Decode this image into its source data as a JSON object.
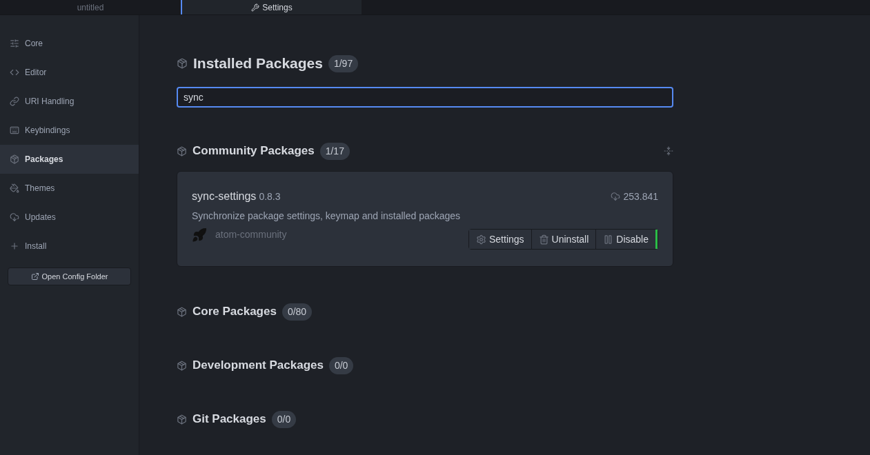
{
  "tabs": [
    {
      "label": "untitled",
      "selected": false
    },
    {
      "label": "Settings",
      "selected": true
    }
  ],
  "sidebar": {
    "items": [
      {
        "label": "Core",
        "selected": false
      },
      {
        "label": "Editor",
        "selected": false
      },
      {
        "label": "URI Handling",
        "selected": false
      },
      {
        "label": "Keybindings",
        "selected": false
      },
      {
        "label": "Packages",
        "selected": true
      },
      {
        "label": "Themes",
        "selected": false
      },
      {
        "label": "Updates",
        "selected": false
      },
      {
        "label": "Install",
        "selected": false
      }
    ],
    "button": "Open Config Folder"
  },
  "installed": {
    "title": "Installed Packages",
    "count": "1/97",
    "search": {
      "value": "sync"
    }
  },
  "sections": [
    {
      "title": "Community Packages",
      "count": "1/17",
      "packages": [
        {
          "name": "sync-settings",
          "version": "0.8.3",
          "downloads": "253.841",
          "description": "Synchronize package settings, keymap and installed packages",
          "author": "atom-community",
          "buttons": [
            "Settings",
            "Uninstall",
            "Disable"
          ],
          "enabled": true
        }
      ]
    },
    {
      "title": "Core Packages",
      "count": "0/80"
    },
    {
      "title": "Development Packages",
      "count": "0/0"
    },
    {
      "title": "Git Packages",
      "count": "0/0"
    }
  ]
}
